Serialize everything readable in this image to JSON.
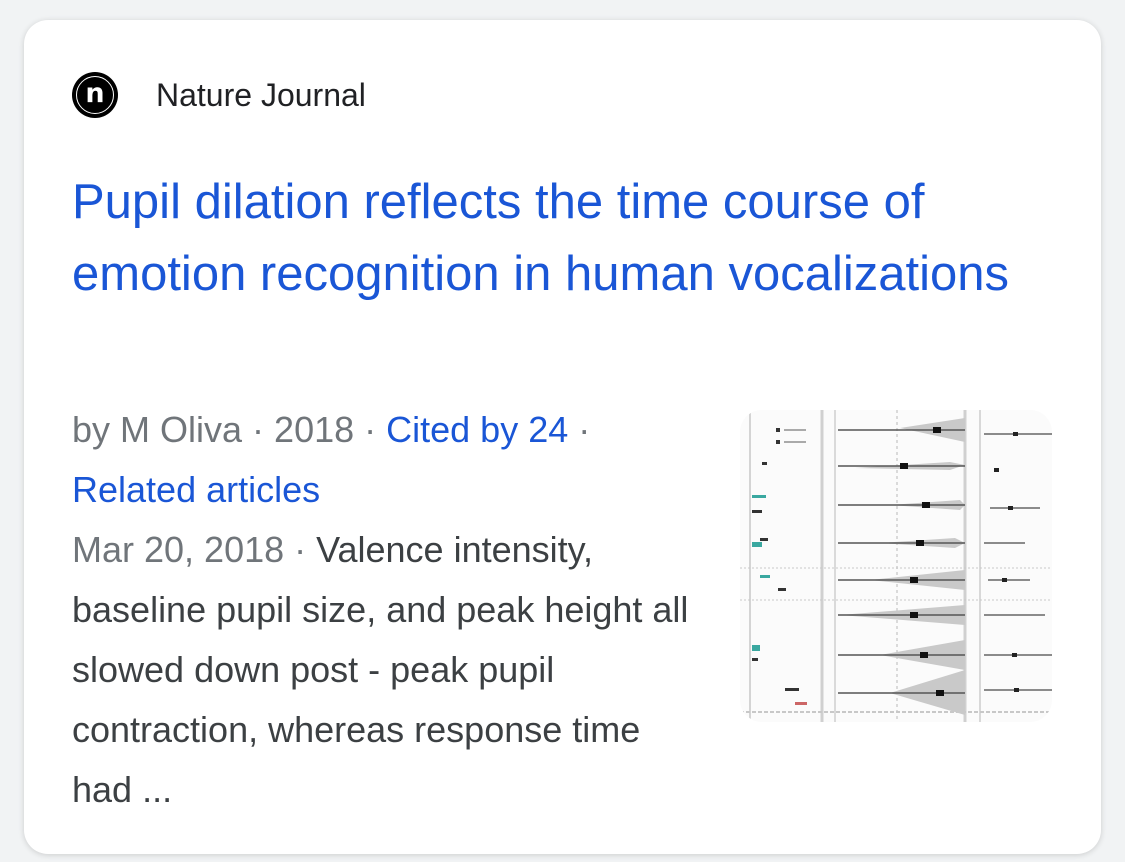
{
  "result": {
    "source": {
      "favicon_letter": "n",
      "favicon_icon": "nature-logo-icon",
      "name": "Nature Journal"
    },
    "title": "Pupil dilation reflects the time course of emotion recognition in human vocalizations",
    "meta": {
      "author": "by M Oliva",
      "separator": " · ",
      "year": "2018",
      "cited_by": "Cited by 24",
      "related": "Related articles"
    },
    "date": "Mar 20, 2018",
    "date_separator": " · ",
    "snippet": "Valence intensity, baseline pupil size, and peak height all slowed down post - peak pupil contraction, whereas response time had ...",
    "thumbnail_icon": "figure-thumbnail-icon"
  },
  "colors": {
    "link": "#1a56d6",
    "text": "#3c4043",
    "muted": "#70757a",
    "card": "#ffffff"
  }
}
